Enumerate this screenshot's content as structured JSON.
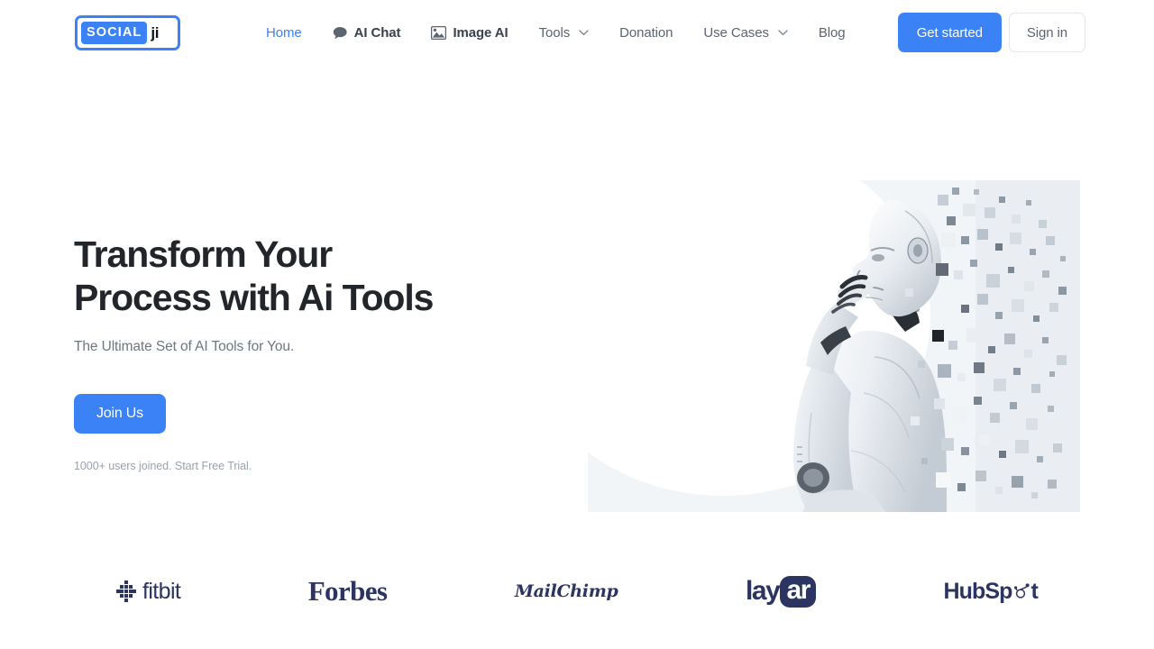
{
  "brand": {
    "mark_text": "SOCIAL",
    "suffix_text": "ji",
    "accent_color": "#3b82f6"
  },
  "nav": {
    "items": [
      {
        "label": "Home",
        "icon": "",
        "active": true,
        "dropdown": false
      },
      {
        "label": "AI Chat",
        "icon": "chat-bubble-icon",
        "active": false,
        "dropdown": false
      },
      {
        "label": "Image AI",
        "icon": "image-icon",
        "active": false,
        "dropdown": false
      },
      {
        "label": "Tools",
        "icon": "",
        "active": false,
        "dropdown": true
      },
      {
        "label": "Donation",
        "icon": "",
        "active": false,
        "dropdown": false
      },
      {
        "label": "Use Cases",
        "icon": "",
        "active": false,
        "dropdown": true
      },
      {
        "label": "Blog",
        "icon": "",
        "active": false,
        "dropdown": false
      }
    ],
    "get_started_label": "Get started",
    "sign_in_label": "Sign in"
  },
  "hero": {
    "title_line1": "Transform Your",
    "title_line2": "Process with Ai Tools",
    "subtitle": "The Ultimate Set of AI Tools for You.",
    "cta_label": "Join Us",
    "note": "1000+ users joined. Start Free Trial.",
    "image_alt": "humanoid robot in thinking pose dispersing into pixels"
  },
  "logos": [
    {
      "name": "fitbit",
      "label": "fitbit",
      "type": "dotmark"
    },
    {
      "name": "forbes",
      "label": "Forbes",
      "type": "serif"
    },
    {
      "name": "mailchimp",
      "label": "MailChimp",
      "type": "script"
    },
    {
      "name": "layar",
      "label": "lay",
      "badge": "ar",
      "type": "pill"
    },
    {
      "name": "hubspot",
      "label_pre": "HubSp",
      "label_post": "t",
      "type": "sprocket"
    }
  ],
  "colors": {
    "accent": "#3b82f6",
    "heading": "#22262b",
    "muted": "#6d7682",
    "logo_navy": "#2c3561"
  }
}
